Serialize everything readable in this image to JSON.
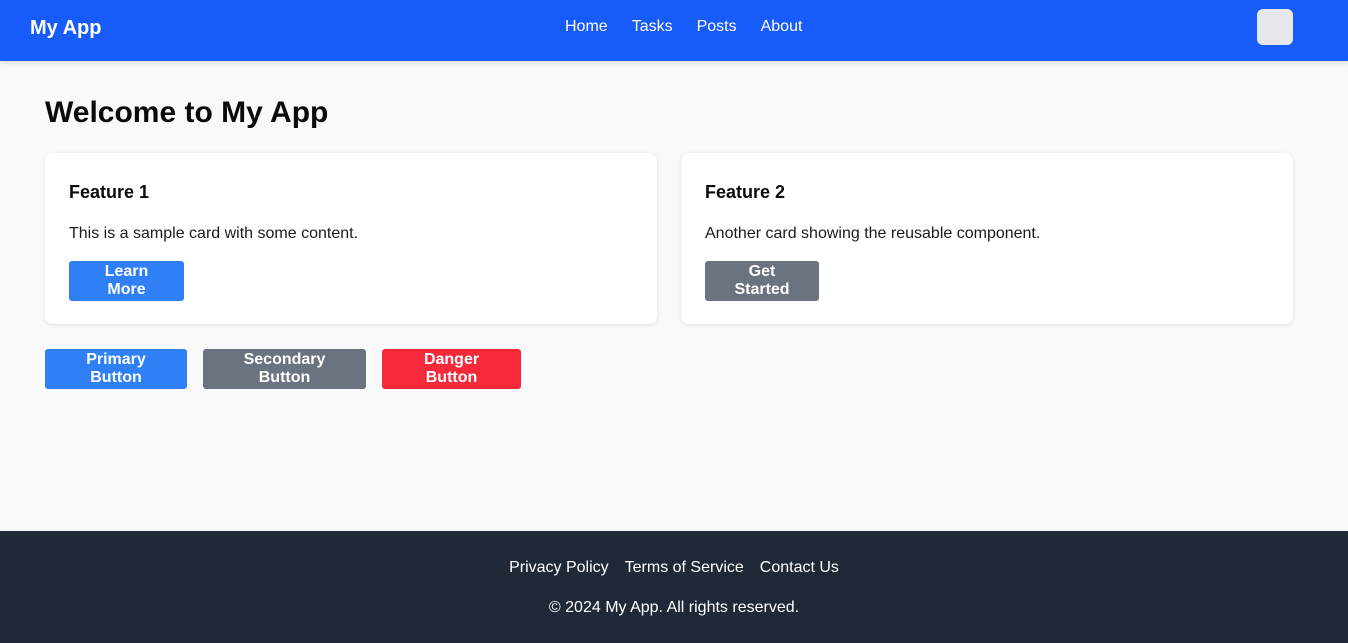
{
  "navbar": {
    "brand": "My App",
    "links": [
      "Home",
      "Tasks",
      "Posts",
      "About"
    ]
  },
  "main": {
    "title": "Welcome to My App",
    "cards": [
      {
        "title": "Feature 1",
        "text": "This is a sample card with some content.",
        "button": "Learn More"
      },
      {
        "title": "Feature 2",
        "text": "Another card showing the reusable component.",
        "button": "Get Started"
      }
    ],
    "buttons": {
      "primary": "Primary Button",
      "secondary": "Secondary Button",
      "danger": "Danger Button"
    }
  },
  "footer": {
    "links": [
      "Privacy Policy",
      "Terms of Service",
      "Contact Us"
    ],
    "copyright": "© 2024 My App. All rights reserved."
  },
  "colors": {
    "navbar": "#175cfa",
    "primary": "#2f80f6",
    "secondary": "#6b7280",
    "danger": "#f6283a",
    "footer": "#1f2937"
  }
}
